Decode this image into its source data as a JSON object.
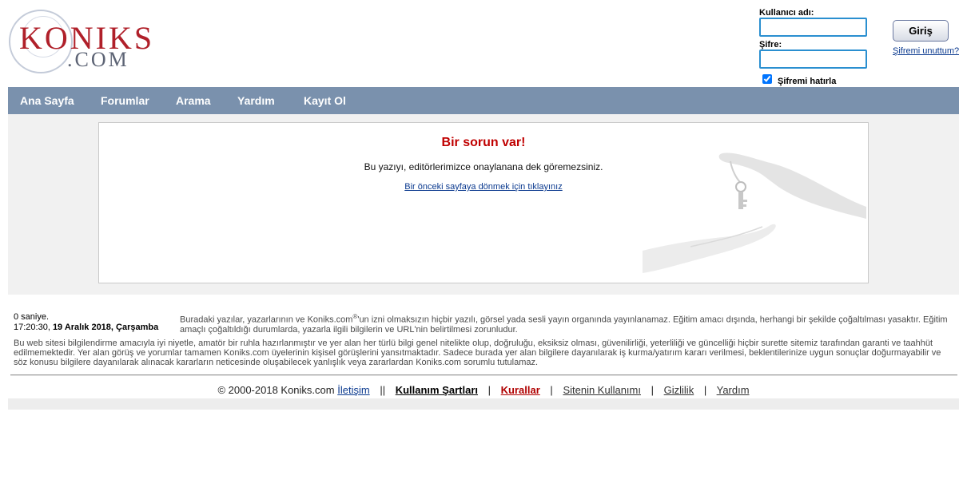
{
  "logo": {
    "main": "KONIKS",
    "suffix": ".COM"
  },
  "login": {
    "username_label": "Kullanıcı adı:",
    "username_value": "",
    "password_label": "Şifre:",
    "password_value": "",
    "remember_label": "Şifremi hatırla",
    "remember_checked": true,
    "submit_label": "Giriş",
    "forgot_link": "Şifremi unuttum?"
  },
  "nav": {
    "items": [
      {
        "label": "Ana Sayfa"
      },
      {
        "label": "Forumlar"
      },
      {
        "label": "Arama"
      },
      {
        "label": "Yardım"
      },
      {
        "label": "Kayıt Ol"
      }
    ]
  },
  "error": {
    "title": "Bir sorun var!",
    "message": "Bu yazıyı, editörlerimizce onaylanana dek göremezsiniz.",
    "back_link": "Bir önceki sayfaya dönmek için tıklayınız"
  },
  "footer": {
    "elapsed": "0 saniye.",
    "time": "17:20:30,",
    "date": "19 Aralık 2018, Çarşamba",
    "copyright_notice_a": "Buradaki yazılar, yazarlarının ve Koniks.com",
    "registered_mark": "®",
    "copyright_notice_b": "'un izni olmaksızın hiçbir yazılı, görsel yada sesli yayın organında yayınlanamaz. Eğitim amacı dışında, herhangi bir şekilde çoğaltılması yasaktır. Eğitim amaçlı çoğaltıldığı durumlarda, yazarla ilgili bilgilerin ve URL'nin belirtilmesi zorunludur.",
    "disclaimer": "Bu web sitesi bilgilendirme amacıyla iyi niyetle, amatör bir ruhla hazırlanmıştır ve yer alan her türlü bilgi genel nitelikte olup, doğruluğu, eksiksiz olması, güvenilirliği, yeterliliği ve güncelliği hiçbir surette sitemiz tarafından garanti ve taahhüt edilmemektedir. Yer alan görüş ve yorumlar tamamen Koniks.com üyelerinin kişisel görüşlerini yansıtmaktadır. Sadece burada yer alan bilgilere dayanılarak iş kurma/yatırım kararı verilmesi, beklentilerinize uygun sonuçlar doğurmayabilir ve söz konusu bilgilere dayanılarak alınacak kararların neticesinde oluşabilecek yanlışlık veya zararlardan Koniks.com sorumlu tutulamaz.",
    "copyright": "© 2000-2018 Koniks.com",
    "links": {
      "contact": "İletişim",
      "terms": "Kullanım Şartları",
      "rules": "Kurallar",
      "usage": "Sitenin Kullanımı",
      "privacy": "Gizlilik",
      "help": "Yardım"
    },
    "sep_single": "|",
    "sep_double": "||"
  }
}
